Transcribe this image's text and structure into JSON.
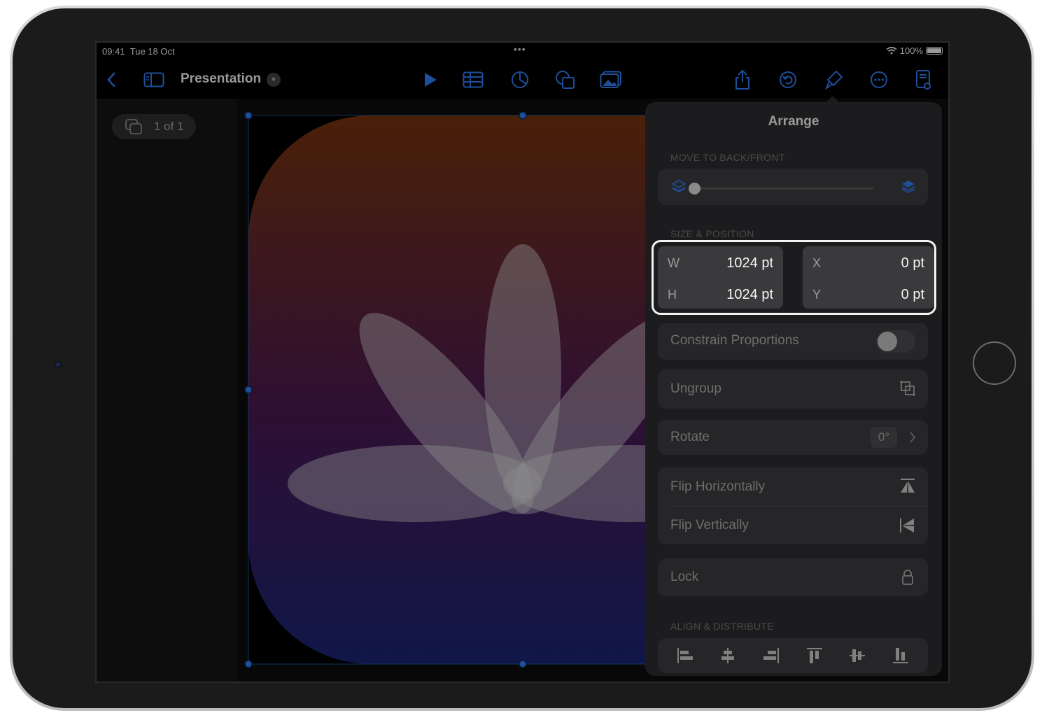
{
  "status_bar": {
    "time": "09:41",
    "date": "Tue 18 Oct",
    "multitask_dots": "•••",
    "battery": "100%"
  },
  "toolbar": {
    "title": "Presentation",
    "icons": [
      "back-icon",
      "sidebar-icon",
      "play-icon",
      "table-icon",
      "chart-icon",
      "shape-icon",
      "media-icon",
      "share-icon",
      "undo-icon",
      "format-icon",
      "more-icon",
      "document-icon"
    ]
  },
  "sidebar": {
    "slide_count": "1 of 1"
  },
  "popover": {
    "title": "Arrange",
    "move_section": "MOVE TO BACK/FRONT",
    "move_slider_value": 0,
    "size_section": "SIZE & POSITION",
    "size": {
      "w_label": "W",
      "w_value": "1024 pt",
      "h_label": "H",
      "h_value": "1024 pt",
      "x_label": "X",
      "x_value": "0 pt",
      "y_label": "Y",
      "y_value": "0 pt"
    },
    "constrain_label": "Constrain Proportions",
    "constrain_on": false,
    "ungroup_label": "Ungroup",
    "rotate_label": "Rotate",
    "rotate_value": "0°",
    "flip_h_label": "Flip Horizontally",
    "flip_v_label": "Flip Vertically",
    "lock_label": "Lock",
    "align_section": "ALIGN & DISTRIBUTE"
  },
  "colors": {
    "accent": "#1e4f9a",
    "highlight_border": "#f2f2f2",
    "popover_bg": "#1c1c1e"
  }
}
